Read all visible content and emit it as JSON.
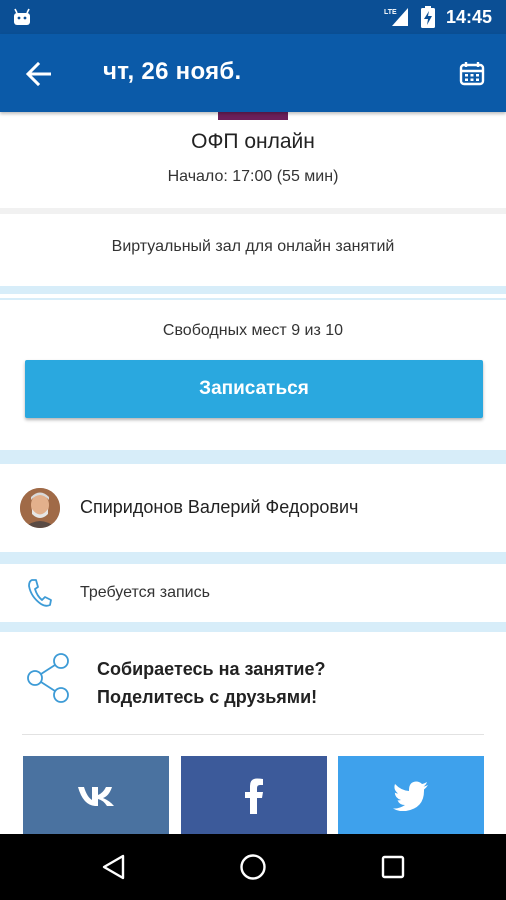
{
  "status_bar": {
    "time": "14:45",
    "network_label": "LTE",
    "icons": [
      "android-icon",
      "lte-signal-icon",
      "battery-charging-icon"
    ]
  },
  "toolbar": {
    "title": "чт, 26 нояб.",
    "back_icon": "arrow-left-icon",
    "calendar_icon": "calendar-icon"
  },
  "class_info": {
    "title": "ОФП онлайн",
    "start": "Начало: 17:00 (55 мин)",
    "accent_color": "#6c1f5a"
  },
  "venue": "Виртуальный зал для онлайн занятий",
  "booking": {
    "seats": "Свободных мест 9 из 10",
    "button_label": "Записаться",
    "button_color": "#2aa8df"
  },
  "trainer": {
    "name": "Спиридонов Валерий Федорович"
  },
  "requirement": {
    "text": "Требуется запись",
    "icon": "phone-icon"
  },
  "share": {
    "line1": "Собираетесь на занятие?",
    "line2": "Поделитесь с друзьями!",
    "icon": "share-icon",
    "buttons": [
      {
        "name": "vk",
        "icon": "vk-icon",
        "color": "#4a72a0"
      },
      {
        "name": "facebook",
        "icon": "facebook-icon",
        "color": "#3c5a9a"
      },
      {
        "name": "twitter",
        "icon": "twitter-icon",
        "color": "#3ea1ec"
      }
    ]
  },
  "theme": {
    "appbar_color": "#0b5aa8",
    "statusbar_color": "#0b4f95",
    "band_color": "#d7edf9"
  },
  "nav_bar": {
    "icons": [
      "back-triangle-icon",
      "home-circle-icon",
      "recents-square-icon"
    ]
  }
}
